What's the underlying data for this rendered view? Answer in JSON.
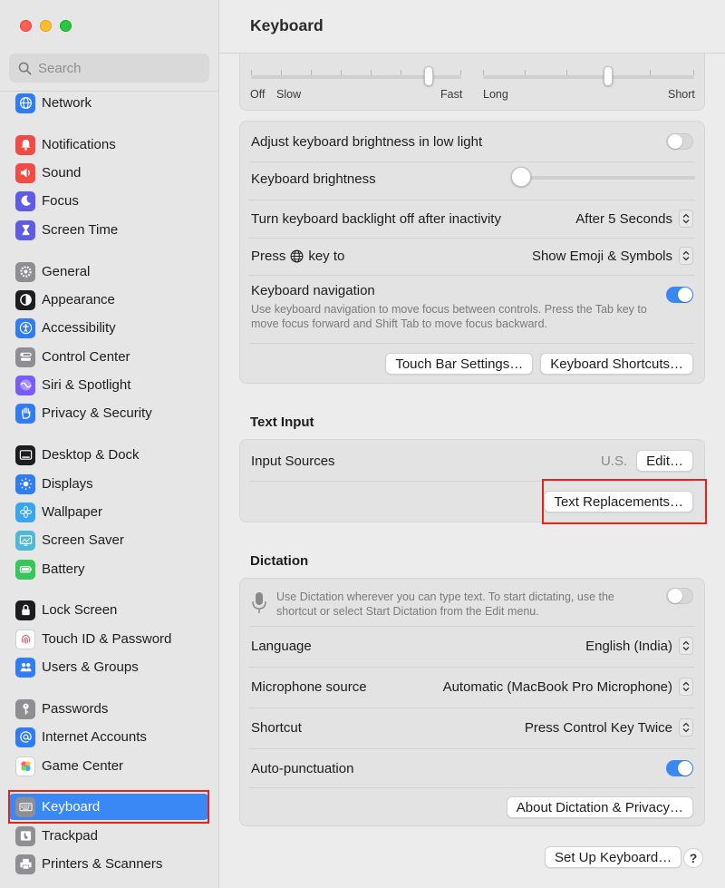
{
  "window": {
    "title": "Keyboard"
  },
  "sidebar": {
    "search_placeholder": "Search",
    "items": [
      {
        "label": "Network",
        "icon": "globe-icon",
        "color": "#2f7cf6"
      },
      {
        "label": "Notifications",
        "icon": "bell-icon",
        "color": "#f04b45"
      },
      {
        "label": "Sound",
        "icon": "speaker-icon",
        "color": "#f04b45"
      },
      {
        "label": "Focus",
        "icon": "moon-icon",
        "color": "#5e5ce6"
      },
      {
        "label": "Screen Time",
        "icon": "hourglass-icon",
        "color": "#5e5ce6"
      },
      {
        "label": "General",
        "icon": "gear-icon",
        "color": "#8e8e93"
      },
      {
        "label": "Appearance",
        "icon": "appearance-icon",
        "color": "#1d1d1f"
      },
      {
        "label": "Accessibility",
        "icon": "accessibility-icon",
        "color": "#2f7cf6"
      },
      {
        "label": "Control Center",
        "icon": "control-center-icon",
        "color": "#8e8e93"
      },
      {
        "label": "Siri & Spotlight",
        "icon": "siri-icon",
        "color": "#7a5af8"
      },
      {
        "label": "Privacy & Security",
        "icon": "hand-icon",
        "color": "#2f7cf6"
      },
      {
        "label": "Desktop & Dock",
        "icon": "dock-icon",
        "color": "#1d1d1f"
      },
      {
        "label": "Displays",
        "icon": "sun-icon",
        "color": "#2f7cf6"
      },
      {
        "label": "Wallpaper",
        "icon": "flower-icon",
        "color": "#37a6f0"
      },
      {
        "label": "Screen Saver",
        "icon": "screen-saver-icon",
        "color": "#4fb8d9"
      },
      {
        "label": "Battery",
        "icon": "battery-icon",
        "color": "#34c759"
      },
      {
        "label": "Lock Screen",
        "icon": "lock-icon",
        "color": "#1d1d1f"
      },
      {
        "label": "Touch ID & Password",
        "icon": "fingerprint-icon",
        "color": "#ffffff"
      },
      {
        "label": "Users & Groups",
        "icon": "users-icon",
        "color": "#2f7cf6"
      },
      {
        "label": "Passwords",
        "icon": "key-icon",
        "color": "#8e8e93"
      },
      {
        "label": "Internet Accounts",
        "icon": "at-icon",
        "color": "#2f7cf6"
      },
      {
        "label": "Game Center",
        "icon": "game-center-icon",
        "color": "#ffffff"
      },
      {
        "label": "Keyboard",
        "icon": "keyboard-icon",
        "color": "#8e8e93"
      },
      {
        "label": "Trackpad",
        "icon": "trackpad-icon",
        "color": "#8e8e93"
      },
      {
        "label": "Printers & Scanners",
        "icon": "printer-icon",
        "color": "#8e8e93"
      }
    ],
    "selected": "Keyboard",
    "accent": "#3a88f5"
  },
  "key_repeat": {
    "left_min": "Off",
    "left_slow": "Slow",
    "left_max": "Fast",
    "right_min": "Long",
    "right_max": "Short"
  },
  "keyboard_settings": {
    "brightness_low_light_label": "Adjust keyboard brightness in low light",
    "brightness_low_light_on": false,
    "brightness_label": "Keyboard brightness",
    "backlight_label": "Turn keyboard backlight off after inactivity",
    "backlight_value": "After 5 Seconds",
    "press_key_prefix": "Press",
    "press_key_suffix": "key to",
    "press_key_value": "Show Emoji & Symbols",
    "nav_label": "Keyboard navigation",
    "nav_desc": "Use keyboard navigation to move focus between controls. Press the Tab key to move focus forward and Shift Tab to move focus backward.",
    "nav_on": true,
    "touch_bar_button": "Touch Bar Settings…",
    "shortcuts_button": "Keyboard Shortcuts…"
  },
  "text_input": {
    "title": "Text Input",
    "input_sources_label": "Input Sources",
    "input_sources_value": "U.S.",
    "edit_button": "Edit…",
    "text_replacements_button": "Text Replacements…"
  },
  "dictation": {
    "title": "Dictation",
    "desc": "Use Dictation wherever you can type text. To start dictating, use the shortcut or select Start Dictation from the Edit menu.",
    "enabled": false,
    "language_label": "Language",
    "language_value": "English (India)",
    "mic_label": "Microphone source",
    "mic_value": "Automatic (MacBook Pro Microphone)",
    "shortcut_label": "Shortcut",
    "shortcut_value": "Press Control Key Twice",
    "autopunct_label": "Auto-punctuation",
    "autopunct_on": true,
    "about_button": "About Dictation & Privacy…"
  },
  "footer": {
    "setup_button": "Set Up Keyboard…",
    "help_label": "?"
  },
  "highlight_color": "#e0261b"
}
